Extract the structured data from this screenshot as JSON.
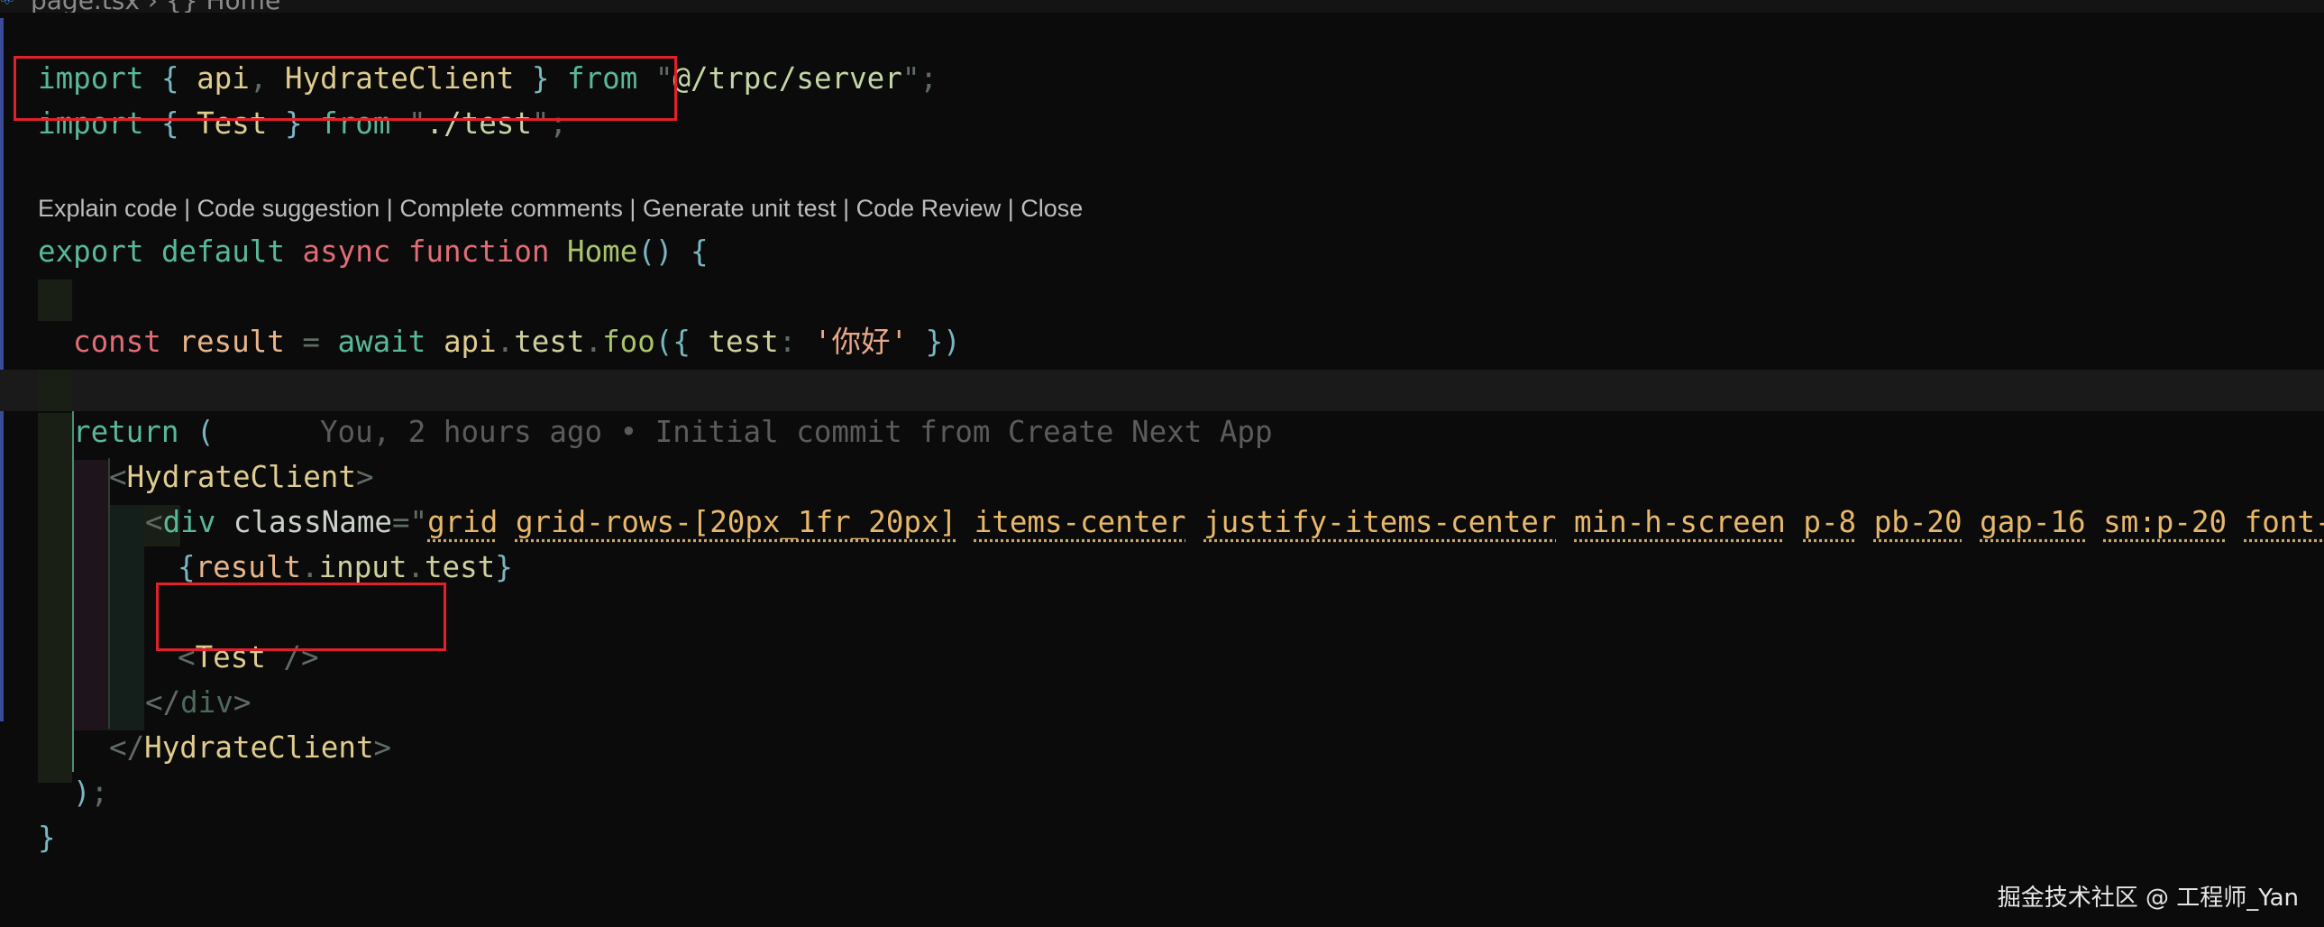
{
  "breadcrumb": {
    "file": "page.tsx",
    "symbol": "Home"
  },
  "lines": {
    "l1": {
      "import": "import",
      "open": " { ",
      "api": "api",
      "comma": ", ",
      "hydrate": "HydrateClient",
      "close": " } ",
      "from": "from",
      "q1": " \"",
      "path": "@/trpc/server",
      "q2": "\"",
      "semi": ";"
    },
    "l2": {
      "import": "import",
      "open": " { ",
      "test": "Test",
      "close": " } ",
      "from": "from",
      "q1": " \"",
      "path": "./test",
      "q2": "\"",
      "semi": ";"
    },
    "l3": {
      "export": "export",
      "default": " default ",
      "async": "async",
      "function": " function ",
      "name": "Home",
      "parens": "()",
      "brace": " {"
    },
    "l4": {
      "const": "const",
      "result": " result ",
      "eq": "=",
      "await": " await ",
      "api": "api",
      "dot1": ".",
      "test": "test",
      "dot2": ".",
      "foo": "foo",
      "open": "({ ",
      "key": "test",
      "colon": ": ",
      "val": "'你好'",
      "close": " })"
    },
    "l5": {
      "return": "return",
      "paren": " ("
    },
    "l6": {
      "lt": "<",
      "tag": "HydrateClient",
      "gt": ">"
    },
    "l7": {
      "lt": "<",
      "tag": "div",
      "attr": " className",
      "eq": "=",
      "q": "\"",
      "classes": [
        "grid",
        "grid-rows-[20px_1fr_20px]",
        "items-center",
        "justify-items-center",
        "min-h-screen",
        "p-8",
        "pb-20",
        "gap-16",
        "sm:p-20",
        "font-[f"
      ]
    },
    "l8": {
      "open": "{",
      "result": "result",
      "dot1": ".",
      "input": "input",
      "dot2": ".",
      "test": "test",
      "close": "}"
    },
    "l9": {
      "lt": "<",
      "tag": "Test",
      "close": " />"
    },
    "l10": {
      "lt": "</",
      "tag": "div",
      "gt": ">"
    },
    "l11": {
      "lt": "</",
      "tag": "HydrateClient",
      "gt": ">"
    },
    "l12": {
      "paren": ")",
      "semi": ";"
    },
    "l13": {
      "brace": "}"
    }
  },
  "codelens": {
    "items": [
      "Explain code",
      "Code suggestion",
      "Complete comments",
      "Generate unit test",
      "Code Review",
      "Close"
    ],
    "separator": " | "
  },
  "blame": {
    "text": "You, 2 hours ago • Initial commit from Create Next App"
  },
  "watermark": "掘金技术社区 @ 工程师_Yan",
  "colors": {
    "highlight_box": "#e0202a",
    "background": "#0b0b0b",
    "current_line": "#1a1a1a"
  }
}
